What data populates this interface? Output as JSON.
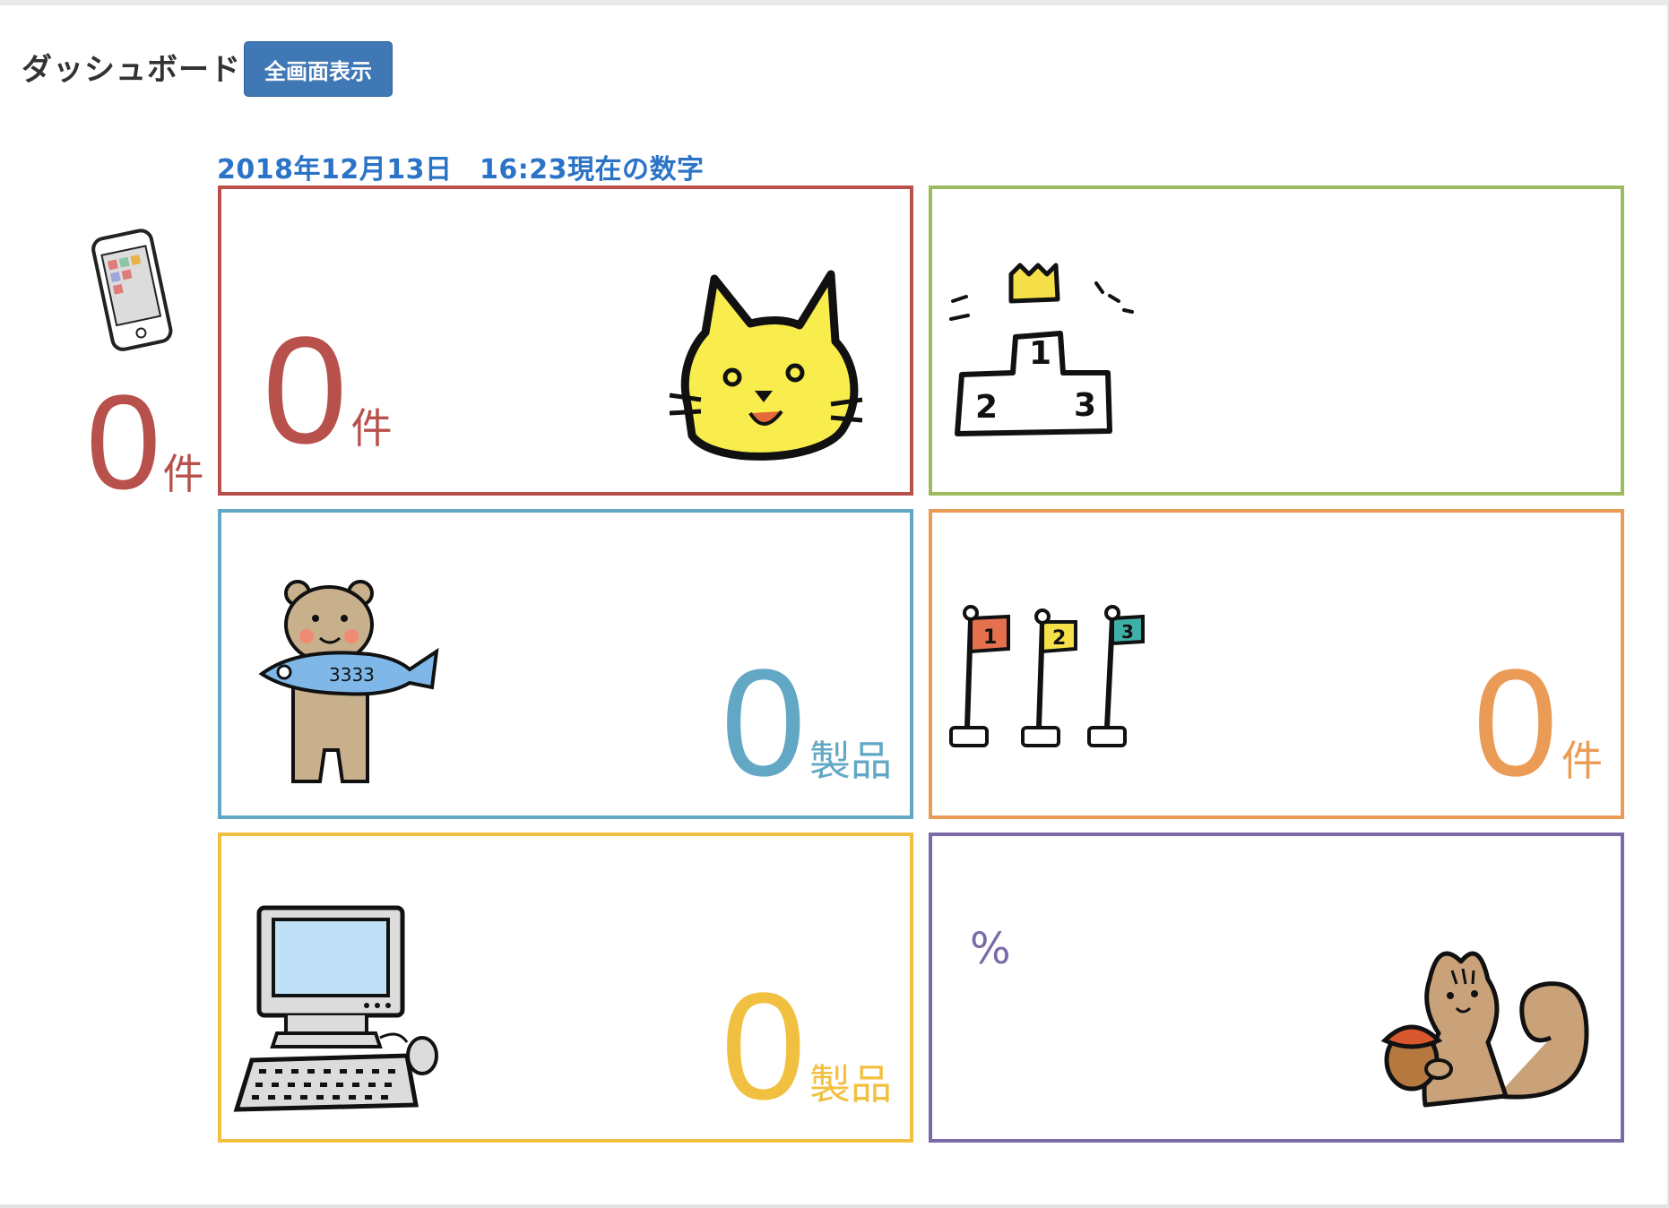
{
  "header": {
    "title": "ダッシュボード",
    "fullscreen_button": "全画面表示"
  },
  "as_of_label": "2018年12月13日　16:23現在の数字",
  "side_metric": {
    "value": "0",
    "unit": "件",
    "icon": "smartphone-icon",
    "color": "#b8514b"
  },
  "cards": [
    {
      "value": "0",
      "unit": "件",
      "illustration": "cat-face-icon",
      "color": "#b8514b"
    },
    {
      "illustration": "podium-icon",
      "color": "#9dbb5c"
    },
    {
      "value": "0",
      "unit": "製品",
      "illustration": "bear-with-fish-icon",
      "color": "#62a8c5"
    },
    {
      "value": "0",
      "unit": "件",
      "illustration": "ranking-flags-icon",
      "color": "#ea9b55"
    },
    {
      "value": "0",
      "unit": "製品",
      "illustration": "desktop-computer-icon",
      "color": "#f1c040"
    },
    {
      "suffix": "%",
      "illustration": "squirrel-icon",
      "color": "#7b6aa8"
    }
  ]
}
